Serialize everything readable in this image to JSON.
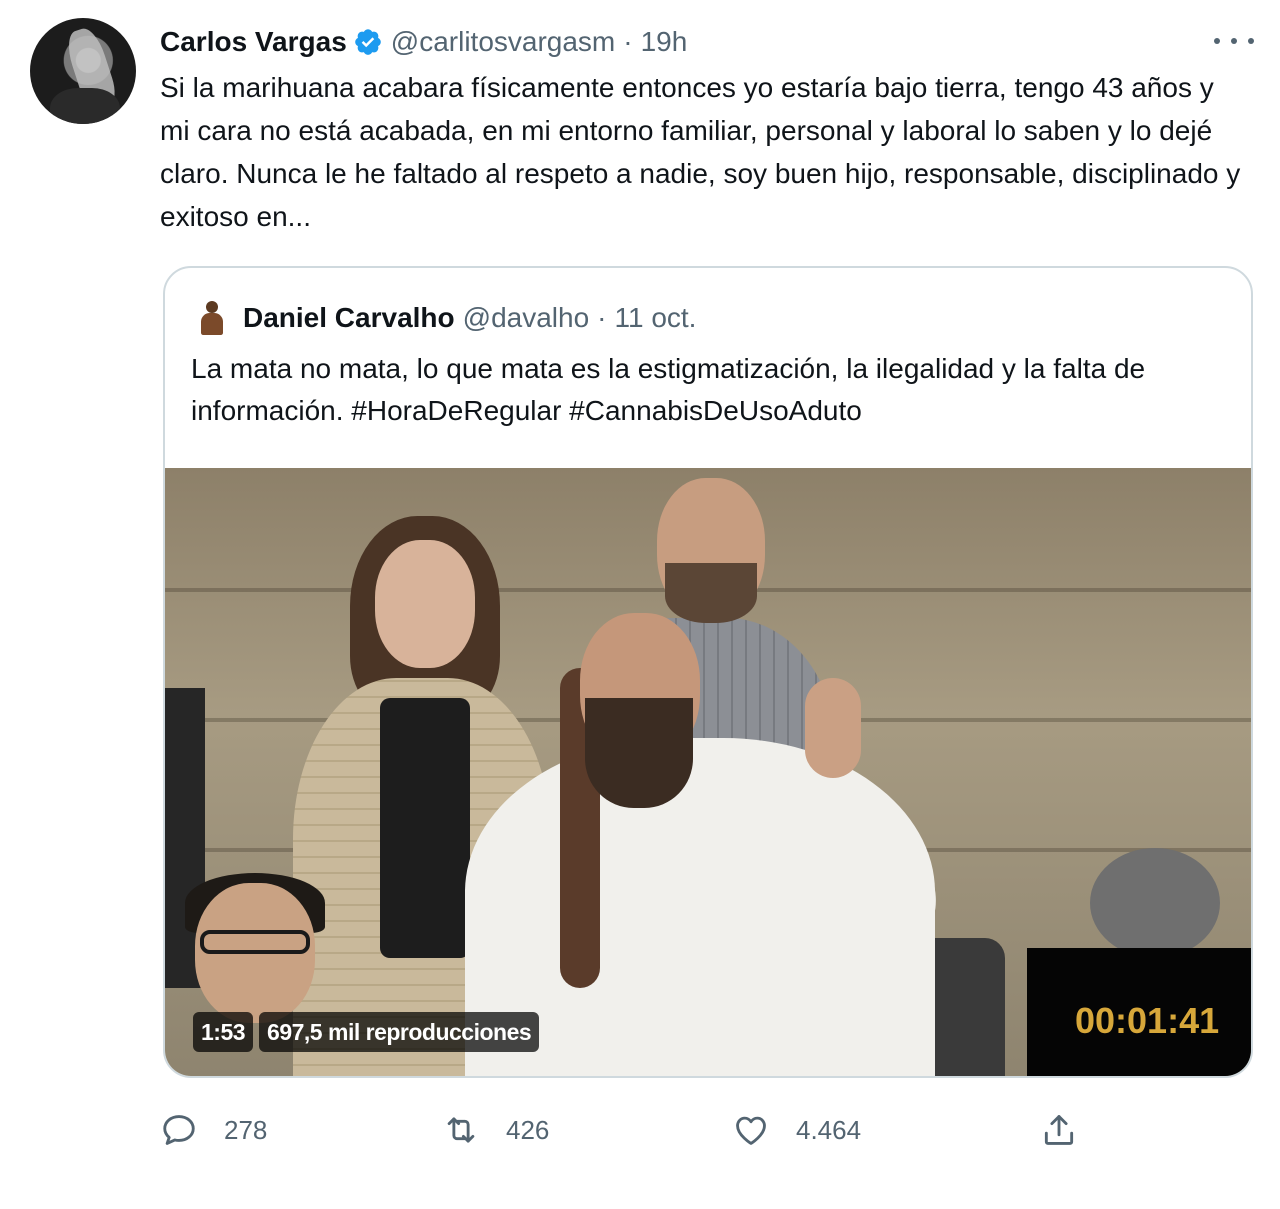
{
  "author": {
    "display_name": "Carlos Vargas",
    "handle": "@carlitosvargasm",
    "separator": "·",
    "time": "19h",
    "verified": true,
    "verified_color": "#1d9bf0"
  },
  "tweet": {
    "text": "Si la marihuana acabara físicamente entonces yo estaría bajo tierra, tengo 43 años y mi cara no está acabada, en mi entorno familiar, personal y laboral lo saben y lo dejé claro. Nunca le he faltado al respeto a nadie, soy buen hijo, responsable, disciplinado y exitoso en..."
  },
  "quoted": {
    "display_name": "Daniel Carvalho",
    "handle": "@davalho",
    "separator": "·",
    "date": "11 oct.",
    "text": "La mata no mata, lo que mata es la estigmatización, la ilegalidad y la falta de información. #HoraDeRegular #CannabisDeUsoAduto",
    "video": {
      "duration": "1:53",
      "views": "697,5 mil reproducciones",
      "overlay_timer": "00:01:41"
    }
  },
  "actions": {
    "reply_count": "278",
    "retweet_count": "426",
    "like_count": "4.464",
    "icons": [
      "reply-icon",
      "retweet-icon",
      "like-icon",
      "share-icon"
    ]
  }
}
